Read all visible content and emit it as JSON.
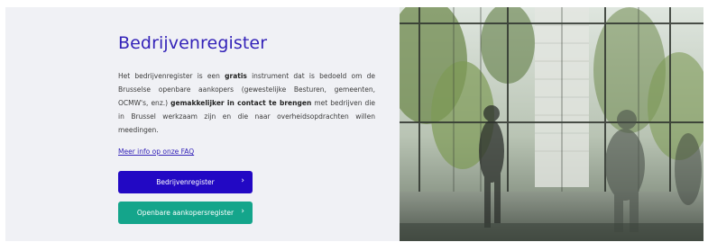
{
  "hero": {
    "title": "Bedrijvenregister",
    "description": {
      "p1": "Het bedrijvenregister is een ",
      "b1": "gratis",
      "p2": " instrument dat is bedoeld om de Brusselse openbare aankopers (gewestelijke Besturen, gemeenten, OCMW's, enz.) ",
      "b2": "gemakkelijker in contact te brengen",
      "p3": " met bedrijven die in Brussel werkzaam zijn en die naar overheidsopdrachten willen meedingen."
    },
    "faq_link": "Meer info op onze FAQ",
    "buttons": {
      "primary": "Bedrijvenregister",
      "secondary": "Openbare aankopersregister",
      "chevron": "›"
    }
  },
  "colors": {
    "primary": "#2208c4",
    "secondary": "#14a58b",
    "title": "#3322b8",
    "panel_bg": "#f0f1f5"
  },
  "image": {
    "subject": "office-lobby-with-people-and-bamboo-photo"
  }
}
